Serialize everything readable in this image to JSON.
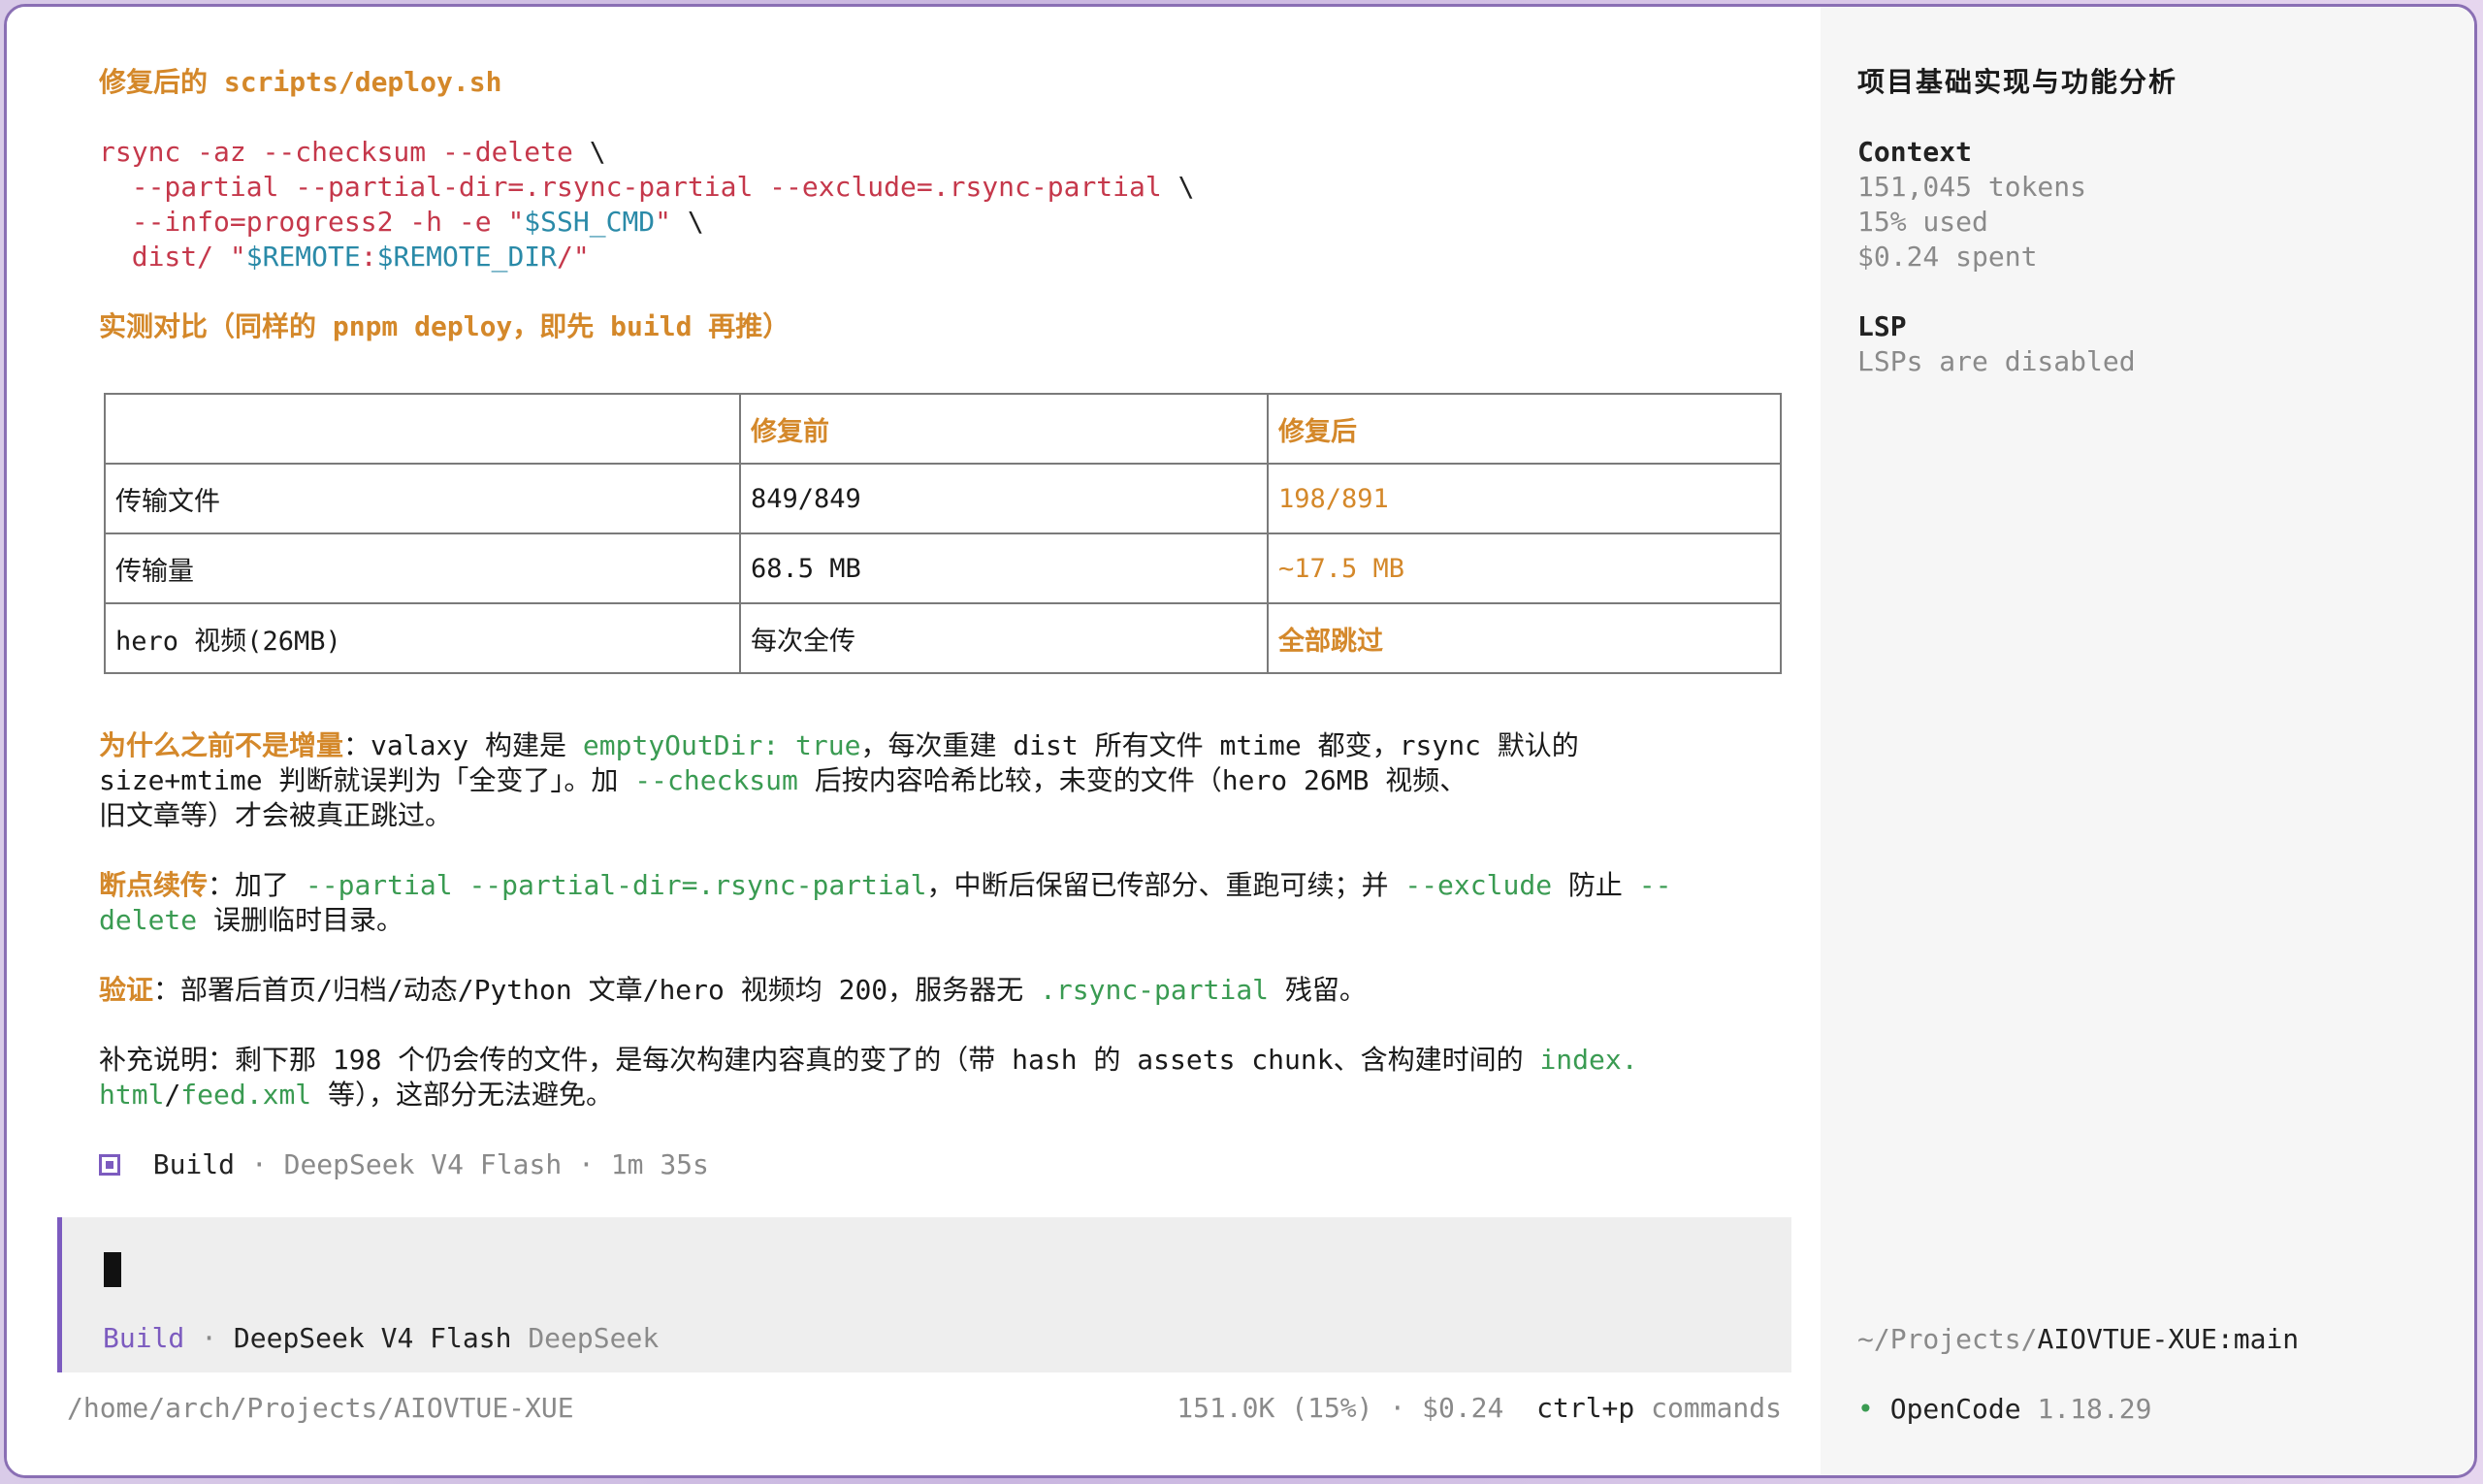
{
  "main": {
    "section1_title": "修复后的 scripts/deploy.sh",
    "code": {
      "line1_cmd": "rsync -az --checksum --delete",
      "line1_end": " \\",
      "line2_cmd": "  --partial --partial-dir=.rsync-partial --exclude=.rsync-partial",
      "line2_end": " \\",
      "line3_pre": "  --info=progress2 -h -e ",
      "line3_q1": "\"",
      "line3_var": "$SSH_CMD",
      "line3_q2": "\"",
      "line3_end": " \\",
      "line4_pre": "  dist/ ",
      "line4_q1": "\"",
      "line4_var1": "$REMOTE",
      "line4_colon": ":",
      "line4_var2": "$REMOTE_DIR",
      "line4_rest": "/\""
    },
    "section2_title": "实测对比（同样的 pnpm deploy，即先 build 再推）",
    "table": {
      "headers": [
        "",
        "修复前",
        "修复后"
      ],
      "rows": [
        [
          "传输文件",
          "849/849",
          "198/891"
        ],
        [
          "传输量",
          "68.5 MB",
          "~17.5 MB"
        ],
        [
          "hero 视频(26MB)",
          "每次全传",
          "全部跳过"
        ]
      ]
    },
    "para1": {
      "label": "为什么之前不是增量",
      "t1": "：valaxy 构建是 ",
      "c1": "emptyOutDir: true",
      "t2": "，每次重建 dist 所有文件 mtime 都变，rsync 默认的",
      "t3": "size+mtime 判断就误判为「全变了」。加 ",
      "c2": "--checksum",
      "t4": " 后按内容哈希比较，未变的文件（hero 26MB 视频、",
      "t5": "旧文章等）才会被真正跳过。"
    },
    "para2": {
      "label": "断点续传",
      "t1": "：加了 ",
      "c1": "--partial --partial-dir=.rsync-partial",
      "t2": "，中断后保留已传部分、重跑可续；并 ",
      "c2": "--exclude",
      "t3": " 防止 ",
      "c3a": "--",
      "c3b": "delete",
      "t4": " 误删临时目录。"
    },
    "para3": {
      "label": "验证",
      "t1": "：部署后首页/归档/动态/Python 文章/hero 视频均 200，服务器无 ",
      "c1": ".rsync-partial",
      "t2": " 残留。"
    },
    "para4": {
      "t1": "补充说明：剩下那 198 个仍会传的文件，是每次构建内容真的变了的（带 hash 的 assets chunk、含构建时间的 ",
      "c1": "index.",
      "c2": "html",
      "slash": "/",
      "c3": "feed.xml",
      "t2": " 等），这部分无法避免。"
    },
    "status": {
      "mode": "Build",
      "sep1": " · ",
      "model": "DeepSeek V4 Flash",
      "sep2": " · ",
      "duration": "1m 35s"
    }
  },
  "input": {
    "mode": "Build",
    "sep": " · ",
    "model": "DeepSeek V4 Flash",
    "provider": "DeepSeek"
  },
  "footer": {
    "path": "/home/arch/Projects/AIOVTUE-XUE",
    "tokens": "151.0K (15%)",
    "sep": " · ",
    "cost": "$0.24",
    "shortcut": "ctrl+p",
    "shortcut_label": "commands"
  },
  "sidebar": {
    "title": "项目基础实现与功能分析",
    "context_label": "Context",
    "tokens": "151,045 tokens",
    "used": "15% used",
    "spent": "$0.24 spent",
    "lsp_label": "LSP",
    "lsp_status": "LSPs are disabled",
    "branch_prefix": "~/Projects/",
    "branch_repo": "AIOVTUE-XUE:main",
    "app_dot": "•",
    "app_name": "OpenCode",
    "app_version": "1.18.29"
  },
  "colors": {
    "accent_orange": "#d4882a",
    "code_red": "#c5384b",
    "code_green": "#3a9b52",
    "mode_purple": "#7c5bbf"
  }
}
